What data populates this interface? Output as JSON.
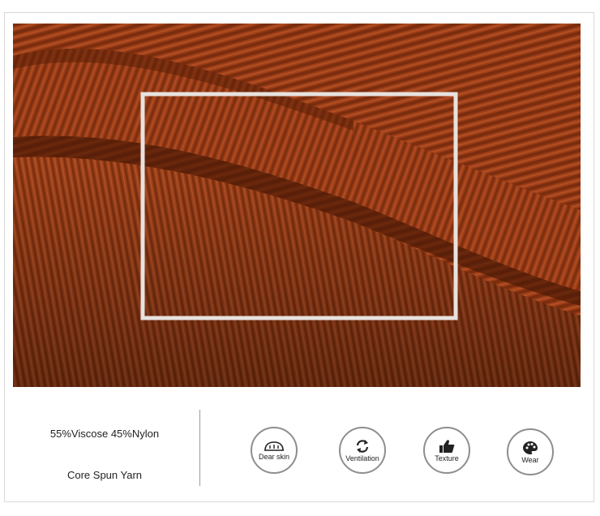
{
  "material": {
    "composition": "55%Viscose 45%Nylon",
    "yarn": "Core Spun Yarn"
  },
  "features": [
    {
      "label": "Dear skin",
      "icon": "skin-icon"
    },
    {
      "label": "Ventilation",
      "icon": "ventilation-icon"
    },
    {
      "label": "Texture",
      "icon": "thumbs-up-icon"
    },
    {
      "label": "Wear",
      "icon": "wear-palette-icon"
    }
  ],
  "colors": {
    "fabric": "#9a3c16",
    "fabric_dark": "#6e2a0e",
    "fabric_light": "#b5532a",
    "badge_border": "#8e8e8e"
  }
}
